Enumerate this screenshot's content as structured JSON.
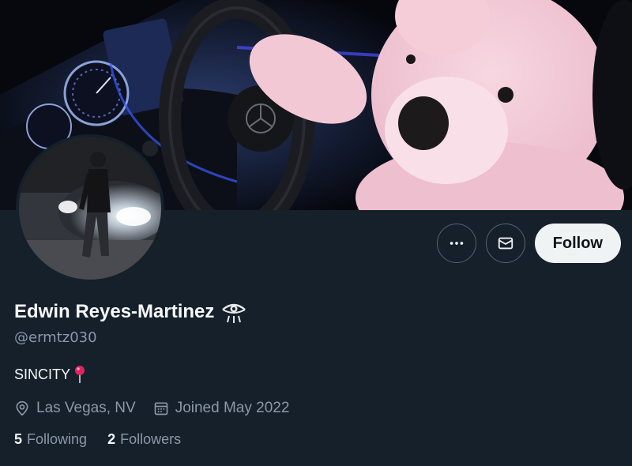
{
  "profile": {
    "display_name": "Edwin Reyes-Martinez",
    "handle": "@ermtz030",
    "bio": "SINCITY",
    "location": "Las Vegas, NV",
    "joined": "Joined May 2022",
    "following_count": "5",
    "following_label": "Following",
    "followers_count": "2",
    "followers_label": "Followers"
  },
  "actions": {
    "more_icon": "more-horizontal-icon",
    "message_icon": "envelope-icon",
    "follow_label": "Follow"
  },
  "icons": {
    "name_badge": "eye-emoji-icon",
    "bio_pin": "round-pushpin-icon",
    "location": "location-pin-icon",
    "calendar": "calendar-icon"
  },
  "colors": {
    "background": "#15202b",
    "text_primary": "#f7f9f9",
    "text_secondary": "#8b98a5",
    "follow_button_bg": "#eff3f4",
    "pin_red": "#e0245e"
  }
}
